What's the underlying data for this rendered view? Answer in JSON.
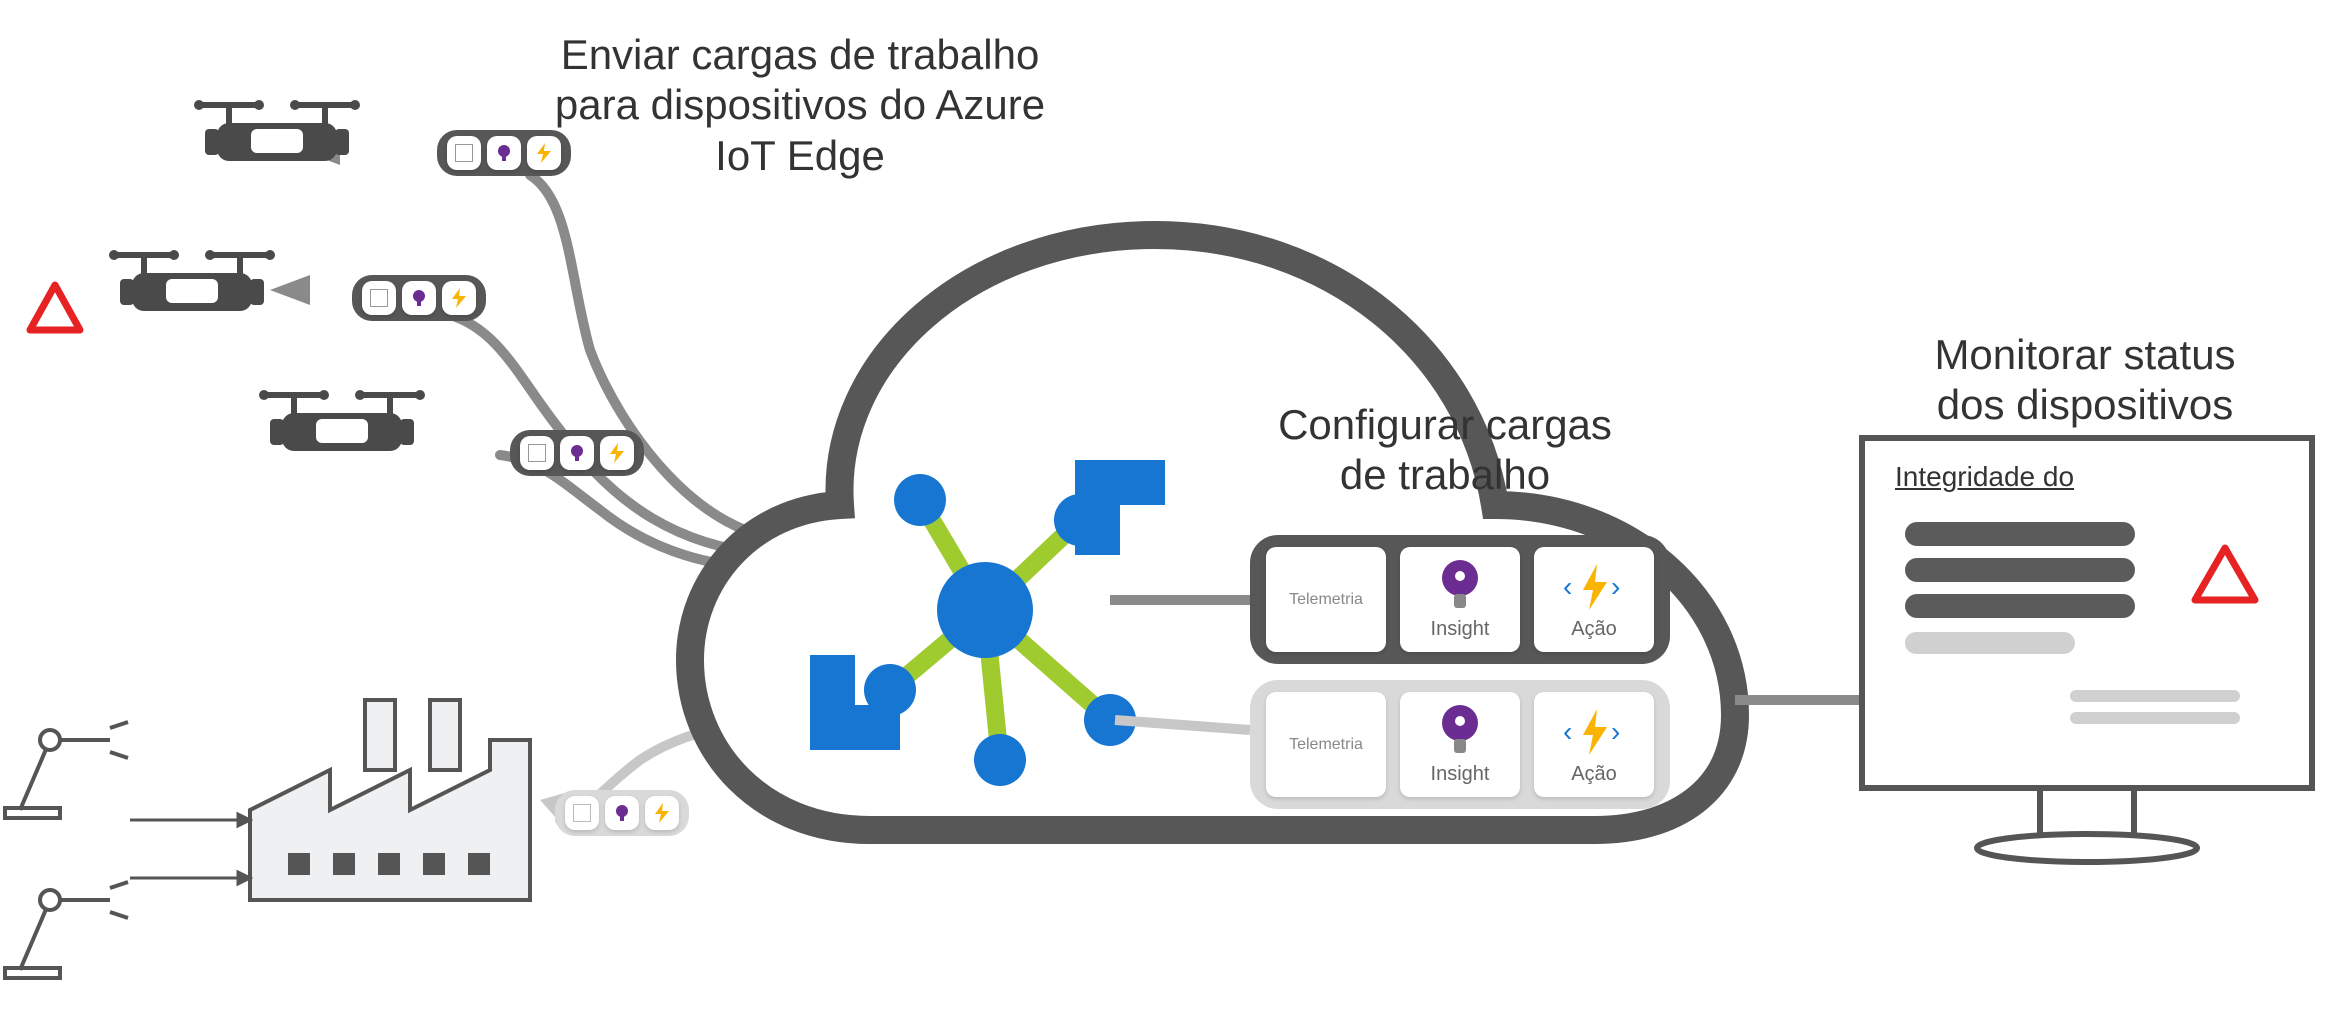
{
  "labels": {
    "send_workloads": "Enviar cargas de trabalho\npara dispositivos do Azure\nIoT Edge",
    "configure_workloads": "Configurar cargas\nde trabalho",
    "monitor_status": "Monitorar status\ndos dispositivos",
    "device_health": "Integridade do"
  },
  "workload_cards": {
    "telemetry": "Telemetria",
    "insight": "Insight",
    "action": "Ação"
  },
  "colors": {
    "cloud_stroke": "#575757",
    "connector": "#8a8a8a",
    "connector_lt": "#c7c7c7",
    "azure_blue": "#1676d2",
    "hub_green": "#a0cb2f",
    "warning_red": "#e62222",
    "insight_purple": "#6b2d91",
    "action_yellow": "#f8b400"
  }
}
